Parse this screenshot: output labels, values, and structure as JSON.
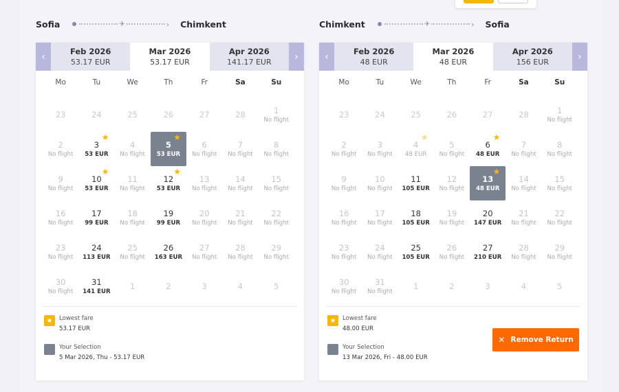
{
  "days_of_week": [
    "Mo",
    "Tu",
    "We",
    "Th",
    "Fr",
    "Sa",
    "Su"
  ],
  "legend": {
    "lowest_label": "Lowest fare",
    "selection_label": "Your Selection"
  },
  "outbound": {
    "from": "Sofia",
    "to": "Chimkent",
    "months": [
      {
        "name": "Feb 2026",
        "price": "53.17 EUR"
      },
      {
        "name": "Mar 2026",
        "price": "53.17 EUR"
      },
      {
        "name": "Apr 2026",
        "price": "141.17 EUR"
      }
    ],
    "lowest_value": "53.17 EUR",
    "selection_value": "5 Mar 2026, Thu - 53.17 EUR",
    "days": [
      {
        "d": "23",
        "s": "",
        "t": "other"
      },
      {
        "d": "24",
        "s": "",
        "t": "other"
      },
      {
        "d": "25",
        "s": "",
        "t": "other"
      },
      {
        "d": "26",
        "s": "",
        "t": "other"
      },
      {
        "d": "27",
        "s": "",
        "t": "other"
      },
      {
        "d": "28",
        "s": "",
        "t": "other"
      },
      {
        "d": "1",
        "s": "No flight",
        "t": "nf"
      },
      {
        "d": "2",
        "s": "No flight",
        "t": "nf"
      },
      {
        "d": "3",
        "s": "53 EUR",
        "t": "avail",
        "star": true
      },
      {
        "d": "4",
        "s": "No flight",
        "t": "nf"
      },
      {
        "d": "5",
        "s": "53 EUR",
        "t": "sel",
        "star": true
      },
      {
        "d": "6",
        "s": "No flight",
        "t": "nf"
      },
      {
        "d": "7",
        "s": "No flight",
        "t": "nf"
      },
      {
        "d": "8",
        "s": "No flight",
        "t": "nf"
      },
      {
        "d": "9",
        "s": "No flight",
        "t": "nf"
      },
      {
        "d": "10",
        "s": "53 EUR",
        "t": "avail",
        "star": true
      },
      {
        "d": "11",
        "s": "No flight",
        "t": "nf"
      },
      {
        "d": "12",
        "s": "53 EUR",
        "t": "avail",
        "star": true
      },
      {
        "d": "13",
        "s": "No flight",
        "t": "nf"
      },
      {
        "d": "14",
        "s": "No flight",
        "t": "nf"
      },
      {
        "d": "15",
        "s": "No flight",
        "t": "nf"
      },
      {
        "d": "16",
        "s": "No flight",
        "t": "nf"
      },
      {
        "d": "17",
        "s": "99 EUR",
        "t": "avail"
      },
      {
        "d": "18",
        "s": "No flight",
        "t": "nf"
      },
      {
        "d": "19",
        "s": "99 EUR",
        "t": "avail"
      },
      {
        "d": "20",
        "s": "No flight",
        "t": "nf"
      },
      {
        "d": "21",
        "s": "No flight",
        "t": "nf"
      },
      {
        "d": "22",
        "s": "No flight",
        "t": "nf"
      },
      {
        "d": "23",
        "s": "No flight",
        "t": "nf"
      },
      {
        "d": "24",
        "s": "113 EUR",
        "t": "avail"
      },
      {
        "d": "25",
        "s": "No flight",
        "t": "nf"
      },
      {
        "d": "26",
        "s": "163 EUR",
        "t": "avail"
      },
      {
        "d": "27",
        "s": "No flight",
        "t": "nf"
      },
      {
        "d": "28",
        "s": "No flight",
        "t": "nf"
      },
      {
        "d": "29",
        "s": "No flight",
        "t": "nf"
      },
      {
        "d": "30",
        "s": "No flight",
        "t": "nf"
      },
      {
        "d": "31",
        "s": "141 EUR",
        "t": "avail"
      },
      {
        "d": "1",
        "s": "",
        "t": "other"
      },
      {
        "d": "2",
        "s": "",
        "t": "other"
      },
      {
        "d": "3",
        "s": "",
        "t": "other"
      },
      {
        "d": "4",
        "s": "",
        "t": "other"
      },
      {
        "d": "5",
        "s": "",
        "t": "other"
      }
    ]
  },
  "return": {
    "from": "Chimkent",
    "to": "Sofia",
    "months": [
      {
        "name": "Feb 2026",
        "price": "48 EUR"
      },
      {
        "name": "Mar 2026",
        "price": "48 EUR"
      },
      {
        "name": "Apr 2026",
        "price": "156 EUR"
      }
    ],
    "lowest_value": "48.00 EUR",
    "selection_value": "13 Mar 2026, Fri - 48.00 EUR",
    "remove_label": "Remove Return",
    "days": [
      {
        "d": "23",
        "s": "",
        "t": "other"
      },
      {
        "d": "24",
        "s": "",
        "t": "other"
      },
      {
        "d": "25",
        "s": "",
        "t": "other"
      },
      {
        "d": "26",
        "s": "",
        "t": "other"
      },
      {
        "d": "27",
        "s": "",
        "t": "other"
      },
      {
        "d": "28",
        "s": "",
        "t": "other"
      },
      {
        "d": "1",
        "s": "No flight",
        "t": "nf"
      },
      {
        "d": "2",
        "s": "No flight",
        "t": "nf"
      },
      {
        "d": "3",
        "s": "No flight",
        "t": "nf"
      },
      {
        "d": "4",
        "s": "48 EUR",
        "t": "faded",
        "star": true,
        "pale": true
      },
      {
        "d": "5",
        "s": "No flight",
        "t": "nf"
      },
      {
        "d": "6",
        "s": "48 EUR",
        "t": "avail",
        "star": true
      },
      {
        "d": "7",
        "s": "No flight",
        "t": "nf"
      },
      {
        "d": "8",
        "s": "No flight",
        "t": "nf"
      },
      {
        "d": "9",
        "s": "No flight",
        "t": "nf"
      },
      {
        "d": "10",
        "s": "No flight",
        "t": "nf"
      },
      {
        "d": "11",
        "s": "105 EUR",
        "t": "avail"
      },
      {
        "d": "12",
        "s": "No flight",
        "t": "nf"
      },
      {
        "d": "13",
        "s": "48 EUR",
        "t": "sel",
        "star": true
      },
      {
        "d": "14",
        "s": "No flight",
        "t": "nf"
      },
      {
        "d": "15",
        "s": "No flight",
        "t": "nf"
      },
      {
        "d": "16",
        "s": "No flight",
        "t": "nf"
      },
      {
        "d": "17",
        "s": "No flight",
        "t": "nf"
      },
      {
        "d": "18",
        "s": "105 EUR",
        "t": "avail"
      },
      {
        "d": "19",
        "s": "No flight",
        "t": "nf"
      },
      {
        "d": "20",
        "s": "147 EUR",
        "t": "avail"
      },
      {
        "d": "21",
        "s": "No flight",
        "t": "nf"
      },
      {
        "d": "22",
        "s": "No flight",
        "t": "nf"
      },
      {
        "d": "23",
        "s": "No flight",
        "t": "nf"
      },
      {
        "d": "24",
        "s": "No flight",
        "t": "nf"
      },
      {
        "d": "25",
        "s": "105 EUR",
        "t": "avail"
      },
      {
        "d": "26",
        "s": "No flight",
        "t": "nf"
      },
      {
        "d": "27",
        "s": "210 EUR",
        "t": "avail"
      },
      {
        "d": "28",
        "s": "No flight",
        "t": "nf"
      },
      {
        "d": "29",
        "s": "No flight",
        "t": "nf"
      },
      {
        "d": "30",
        "s": "No flight",
        "t": "nf"
      },
      {
        "d": "31",
        "s": "No flight",
        "t": "nf"
      },
      {
        "d": "1",
        "s": "",
        "t": "other"
      },
      {
        "d": "2",
        "s": "",
        "t": "other"
      },
      {
        "d": "3",
        "s": "",
        "t": "other"
      },
      {
        "d": "4",
        "s": "",
        "t": "other"
      },
      {
        "d": "5",
        "s": "",
        "t": "other"
      }
    ]
  }
}
